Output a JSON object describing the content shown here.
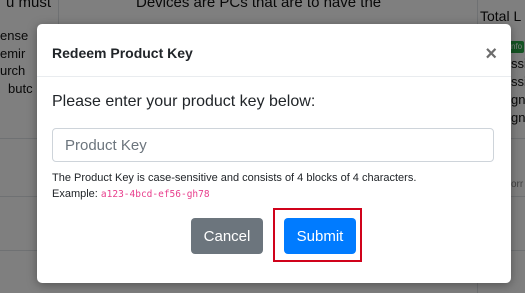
{
  "background": {
    "fragments": [
      {
        "id": "bg-frag-1",
        "text": "u must"
      },
      {
        "id": "bg-frag-2",
        "text": "Devices are PCs that are to have the"
      },
      {
        "id": "bg-frag-3",
        "text": "Total L"
      },
      {
        "id": "bg-frag-4",
        "text": "ense"
      },
      {
        "id": "bg-frag-5",
        "text": "emir"
      },
      {
        "id": "bg-frag-6",
        "text": "urch"
      },
      {
        "id": "bg-frag-7",
        "text": "butc"
      },
      {
        "id": "bg-frag-8",
        "text": "ssi"
      },
      {
        "id": "bg-frag-9",
        "text": "ssi"
      },
      {
        "id": "bg-frag-10",
        "text": "gn"
      },
      {
        "id": "bg-frag-11",
        "text": "gn"
      },
      {
        "id": "bg-frag-12",
        "text": "orr"
      }
    ],
    "badge": "nfo"
  },
  "modal": {
    "title": "Redeem Product Key",
    "close_symbol": "×",
    "prompt": "Please enter your product key below:",
    "input": {
      "placeholder": "Product Key",
      "value": ""
    },
    "help_text": "The Product Key is case-sensitive and consists of 4 blocks of 4 characters.",
    "example_label": "Example:",
    "example_code": "a123-4bcd-ef56-gh78",
    "cancel_label": "Cancel",
    "submit_label": "Submit"
  },
  "colors": {
    "primary": "#007bff",
    "secondary": "#6c757d",
    "highlight": "#d0021b",
    "code": "#e83e8c",
    "badge": "#28a745"
  }
}
